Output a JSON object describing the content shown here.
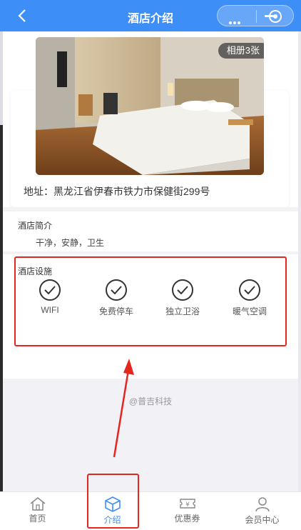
{
  "header": {
    "title": "酒店介绍"
  },
  "hotel": {
    "album_label": "相册3张",
    "address": "地址：黑龙江省伊春市铁力市保健街299号",
    "intro_title": "酒店简介",
    "intro_text": "干净，安静，卫生",
    "facilities_title": "酒店设施",
    "facilities": [
      {
        "label": "WIFI",
        "icon": "check-circle-icon"
      },
      {
        "label": "免费停车",
        "icon": "check-circle-icon"
      },
      {
        "label": "独立卫浴",
        "icon": "check-circle-icon"
      },
      {
        "label": "暖气空调",
        "icon": "check-circle-icon"
      }
    ]
  },
  "watermark": "@普吉科技",
  "tabbar": [
    {
      "label": "首页",
      "icon": "home-icon"
    },
    {
      "label": "介绍",
      "icon": "cube-icon"
    },
    {
      "label": "优惠券",
      "icon": "coupon-icon"
    },
    {
      "label": "会员中心",
      "icon": "user-icon"
    }
  ],
  "colors": {
    "header": "#3e8ef7",
    "active_tab": "#3e8ef7",
    "annotation": "#e5261f"
  }
}
